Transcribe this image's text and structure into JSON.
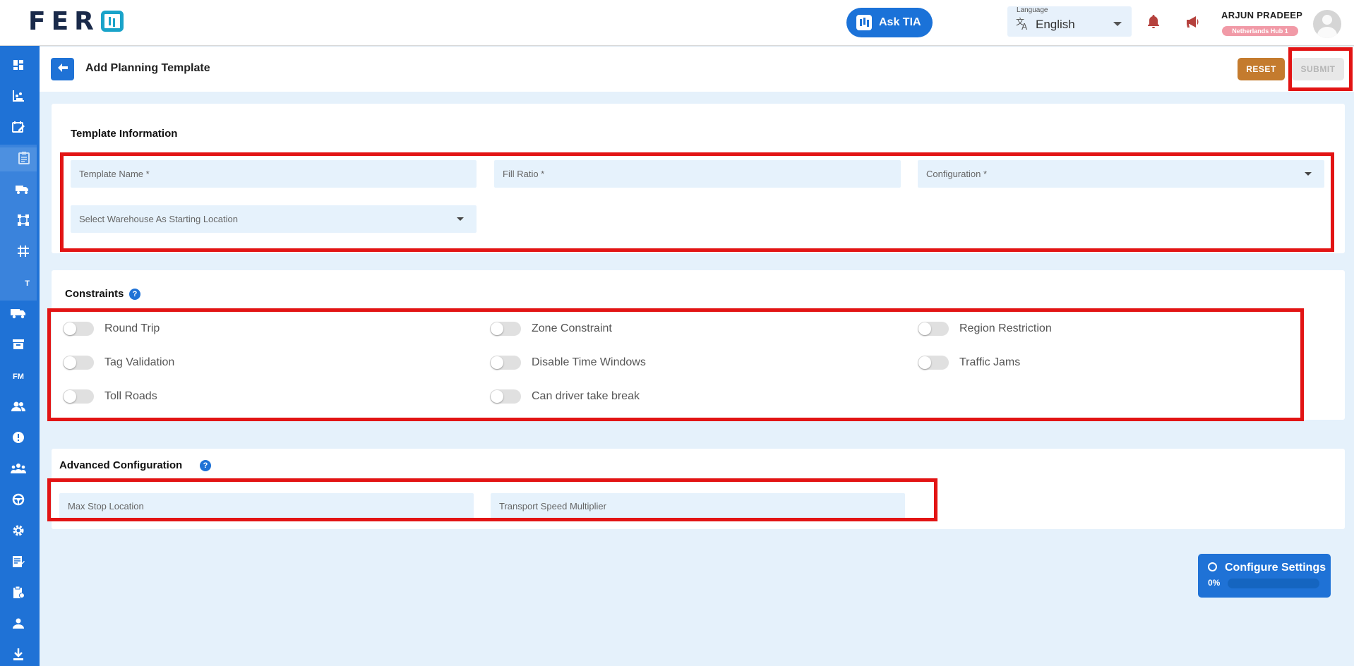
{
  "header": {
    "logo_text": "FER",
    "ask_tia": "Ask TIA",
    "language": {
      "caption": "Language",
      "value": "English"
    },
    "user": {
      "name": "ARJUN PRADEEP",
      "hub": "Netherlands Hub 1"
    }
  },
  "sidebar": {
    "items": [
      {
        "icon": "dashboard-icon"
      },
      {
        "icon": "analytics-icon"
      },
      {
        "icon": "planning-icon"
      },
      {
        "icon": "template-icon",
        "active": true
      },
      {
        "icon": "truck-settings-icon"
      },
      {
        "icon": "network-icon"
      },
      {
        "icon": "grid-icon"
      },
      {
        "icon": "text-t-icon",
        "text": "T"
      },
      {
        "icon": "delivery-truck-icon"
      },
      {
        "icon": "archive-icon"
      },
      {
        "icon": "fm-icon",
        "text": "FM"
      },
      {
        "icon": "users-icon"
      },
      {
        "icon": "info-icon"
      },
      {
        "icon": "team-icon"
      },
      {
        "icon": "steering-wheel-icon"
      },
      {
        "icon": "settings-icon"
      },
      {
        "icon": "notes-icon"
      },
      {
        "icon": "clipboard-icon"
      },
      {
        "icon": "user-badge-icon"
      },
      {
        "icon": "download-icon"
      }
    ]
  },
  "page": {
    "title": "Add Planning Template",
    "reset_label": "RESET",
    "submit_label": "SUBMIT"
  },
  "template_info": {
    "title": "Template Information",
    "template_name_placeholder": "Template Name *",
    "fill_ratio_placeholder": "Fill Ratio *",
    "configuration_placeholder": "Configuration *",
    "warehouse_placeholder": "Select Warehouse As Starting Location"
  },
  "constraints": {
    "title": "Constraints",
    "help": "?",
    "items": [
      {
        "label": "Round Trip",
        "enabled": false
      },
      {
        "label": "Zone Constraint",
        "enabled": false
      },
      {
        "label": "Region Restriction",
        "enabled": false
      },
      {
        "label": "Tag Validation",
        "enabled": false
      },
      {
        "label": "Disable Time Windows",
        "enabled": false
      },
      {
        "label": "Traffic Jams",
        "enabled": false
      },
      {
        "label": "Toll Roads",
        "enabled": false
      },
      {
        "label": "Can driver take break",
        "enabled": false
      }
    ]
  },
  "advanced": {
    "title": "Advanced Configuration",
    "help": "?",
    "max_stop_placeholder": "Max Stop Location",
    "speed_multiplier_placeholder": "Transport Speed Multiplier"
  },
  "config_widget": {
    "title": "Configure Settings",
    "progress_text": "0%",
    "progress": 0
  },
  "colors": {
    "primary": "#1f72d6",
    "reset": "#c47b2e",
    "highlight": "#e21414",
    "field_bg": "#e6f2fc",
    "page_bg": "#e5f1fb"
  }
}
